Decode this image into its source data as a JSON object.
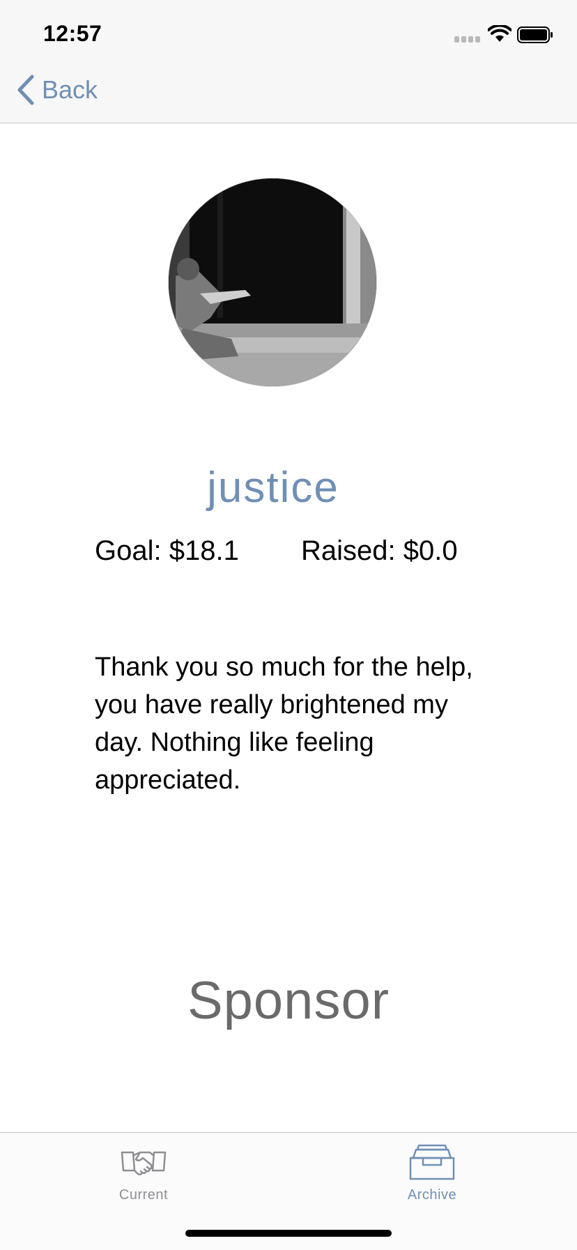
{
  "status_bar": {
    "time": "12:57",
    "signal_icon": "cellular-signal-icon",
    "wifi_icon": "wifi-icon",
    "battery_icon": "battery-icon"
  },
  "nav": {
    "back_label": "Back",
    "back_icon": "chevron-left-icon"
  },
  "profile": {
    "name": "justice",
    "goal_text": "Goal: $18.1",
    "raised_text": "Raised: $0.0",
    "message": "Thank you so much for the help, you have really brightened my day. Nothing like feeling appreciated."
  },
  "actions": {
    "sponsor_label": "Sponsor"
  },
  "tab_bar": {
    "tabs": [
      {
        "label": "Current",
        "icon": "handshake-icon",
        "selected": false
      },
      {
        "label": "Archive",
        "icon": "archive-box-icon",
        "selected": true
      }
    ]
  },
  "colors": {
    "accent": "#6f8fb5",
    "tab_inactive": "#8e8e93",
    "sponsor_text": "#6a6a6a"
  }
}
